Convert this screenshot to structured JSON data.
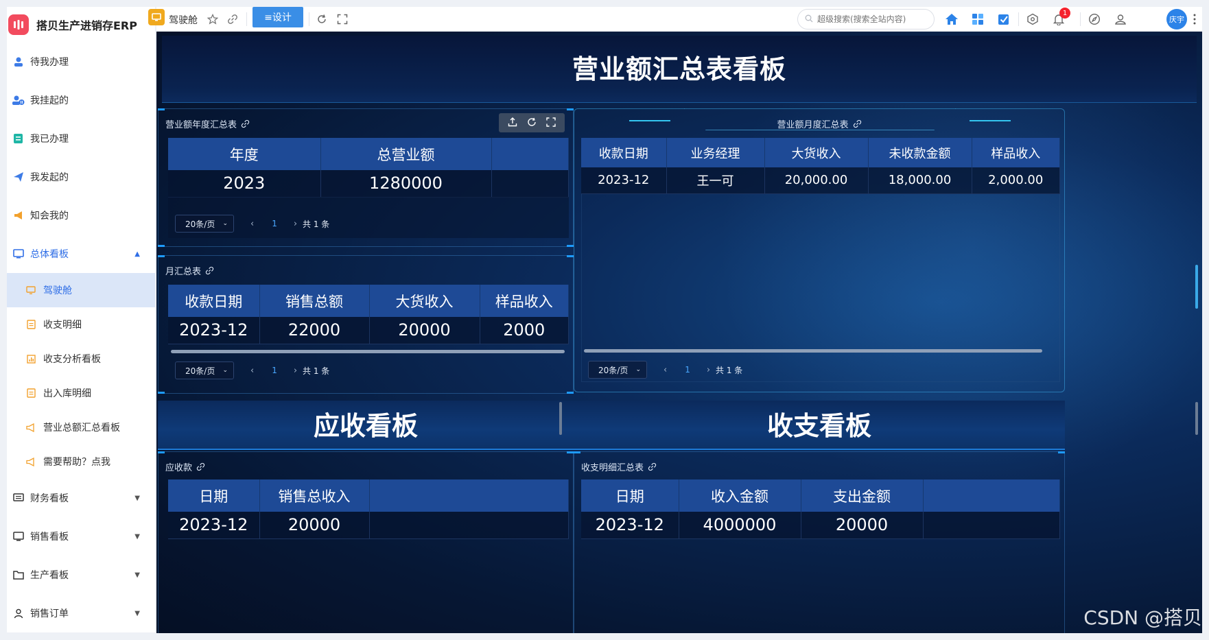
{
  "app": {
    "name": "搭贝生产进销存ERP",
    "logo_text": "搭"
  },
  "sidebar": {
    "items": [
      {
        "label": "待我办理"
      },
      {
        "label": "我挂起的"
      },
      {
        "label": "我已办理"
      },
      {
        "label": "我发起的"
      },
      {
        "label": "知会我的"
      }
    ],
    "group_open": {
      "label": "总体看板",
      "children": [
        {
          "label": "驾驶舱"
        },
        {
          "label": "收支明细"
        },
        {
          "label": "收支分析看板"
        },
        {
          "label": "出入库明细"
        },
        {
          "label": "营业总额汇总看板"
        },
        {
          "label": "需要帮助？点我"
        }
      ]
    },
    "groups_closed": [
      {
        "label": "财务看板"
      },
      {
        "label": "销售看板"
      },
      {
        "label": "生产看板"
      },
      {
        "label": "销售订单"
      }
    ]
  },
  "topbar": {
    "current_page": "驾驶舱",
    "design_button": "≡设计",
    "search_placeholder": "超级搜索(搜索全站内容)",
    "notification_count": "1",
    "user_avatar": "庆宇"
  },
  "dashboard": {
    "title": "营业额汇总表看板",
    "year_panel": {
      "title": "营业额年度汇总表",
      "columns": [
        "年度",
        "总营业额",
        ""
      ],
      "rows": [
        [
          "2023",
          "1280000",
          ""
        ]
      ],
      "page_size": "20条/页",
      "page": "1",
      "total": "共 1 条"
    },
    "month_summary": {
      "title": "月汇总表",
      "columns": [
        "收款日期",
        "销售总额",
        "大货收入",
        "样品收入"
      ],
      "rows": [
        [
          "2023-12",
          "22000",
          "20000",
          "2000"
        ]
      ],
      "page_size": "20条/页",
      "page": "1",
      "total": "共 1 条"
    },
    "month_panel": {
      "title": "营业额月度汇总表",
      "columns": [
        "收款日期",
        "业务经理",
        "大货收入",
        "未收款金额",
        "样品收入"
      ],
      "rows": [
        [
          "2023-12",
          "王一可",
          "20,000.00",
          "18,000.00",
          "2,000.00"
        ]
      ],
      "page_size": "20条/页",
      "page": "1",
      "total": "共 1 条"
    },
    "receivable_title": "应收看板",
    "cashflow_title": "收支看板",
    "receivable_panel": {
      "title": "应收款",
      "columns": [
        "日期",
        "销售总收入",
        ""
      ],
      "rows": [
        [
          "2023-12",
          "20000",
          ""
        ]
      ]
    },
    "cashflow_panel": {
      "title": "收支明细汇总表",
      "columns": [
        "日期",
        "收入金额",
        "支出金额",
        ""
      ],
      "rows": [
        [
          "2023-12",
          "4000000",
          "20000",
          ""
        ]
      ]
    }
  },
  "watermark": "CSDN @搭贝"
}
